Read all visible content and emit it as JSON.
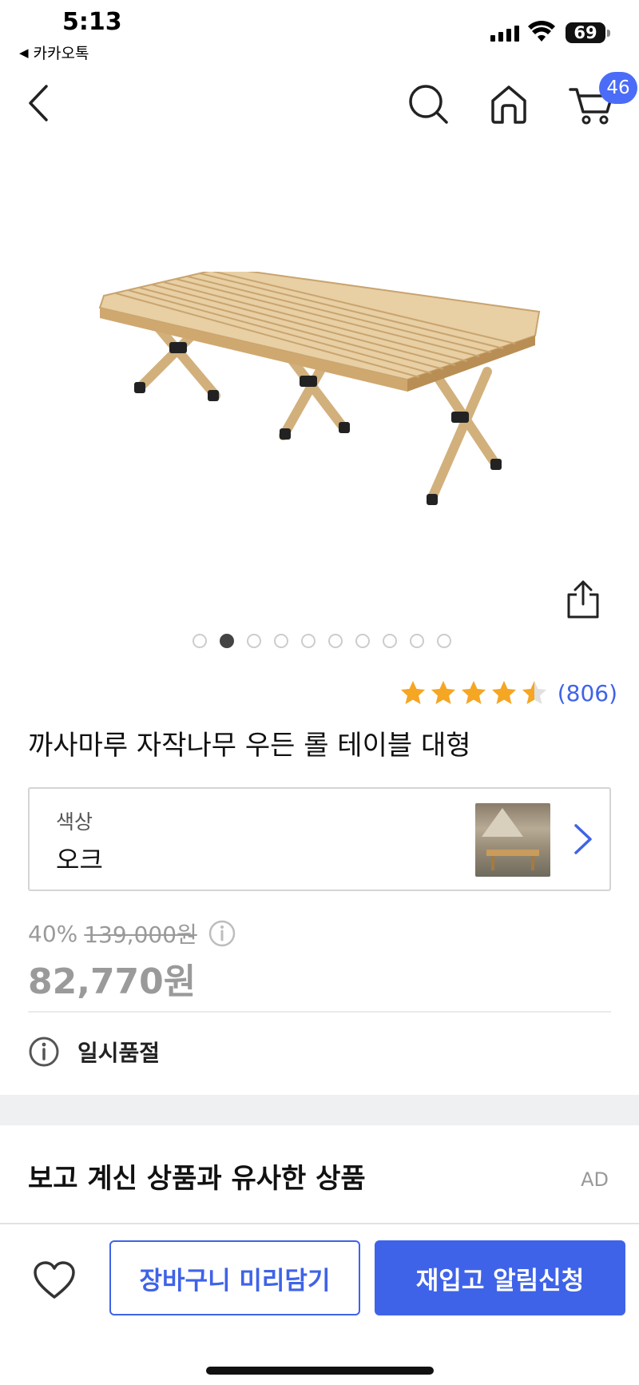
{
  "status_bar": {
    "time": "5:13",
    "back_app": "카카오톡",
    "battery": "69",
    "icons": [
      "signal-icon",
      "wifi-icon",
      "battery-icon"
    ]
  },
  "nav": {
    "cart_count": "46",
    "icons": [
      "chevron-left-icon",
      "search-icon",
      "home-icon",
      "cart-icon"
    ]
  },
  "gallery": {
    "total_images": 10,
    "current_index": 2
  },
  "product": {
    "rating": 4.5,
    "review_count": "(806)",
    "title": "까사마루 자작나무 우든 롤 테이블 대형"
  },
  "option": {
    "label": "색상",
    "value": "오크"
  },
  "price": {
    "discount": "40%",
    "original": "139,000원",
    "sale": "82,770원"
  },
  "status": {
    "text": "일시품절"
  },
  "similar": {
    "title": "보고 계신 상품과 유사한 상품",
    "ad_label": "AD"
  },
  "bottom": {
    "cart_button": "장바구니 미리담기",
    "restock_button": "재입고 알림신청"
  },
  "colors": {
    "accent": "#3f63e8",
    "star": "#f5a623",
    "muted": "#9a9a9a"
  }
}
